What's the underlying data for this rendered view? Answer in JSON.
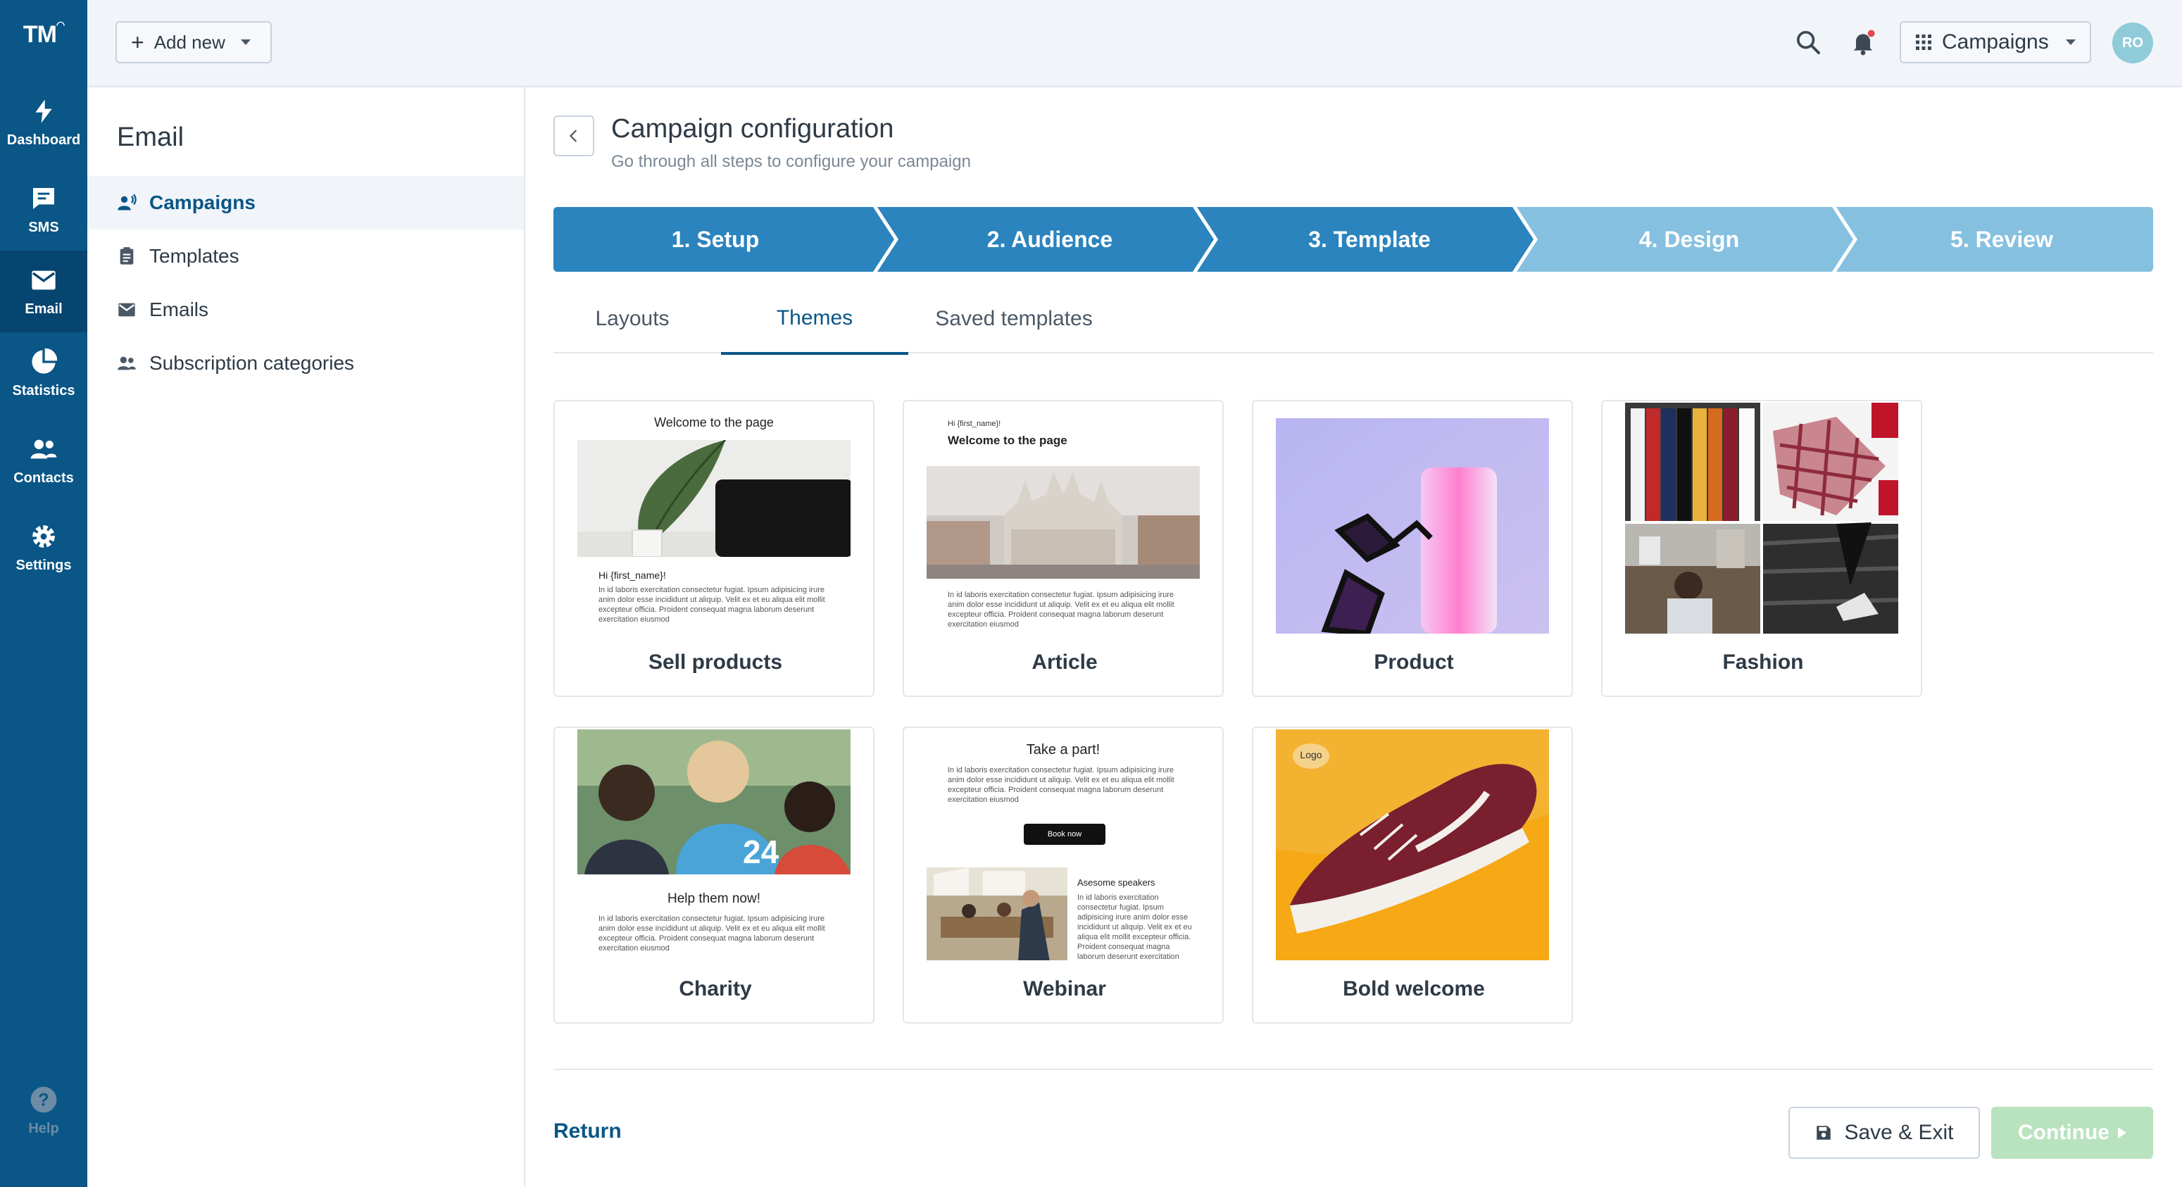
{
  "brand": {
    "logo_text": "TM",
    "accent": "#0a5686",
    "step_active": "#2b84bd",
    "step_inactive": "#86c0e0"
  },
  "rail": {
    "items": [
      {
        "label": "Dashboard",
        "icon": "bolt-icon"
      },
      {
        "label": "SMS",
        "icon": "chat-icon"
      },
      {
        "label": "Email",
        "icon": "envelope-icon",
        "active": true
      },
      {
        "label": "Statistics",
        "icon": "pie-chart-icon"
      },
      {
        "label": "Contacts",
        "icon": "people-icon"
      },
      {
        "label": "Settings",
        "icon": "gear-icon"
      }
    ],
    "help_label": "Help"
  },
  "topbar": {
    "add_new_label": "Add new",
    "campaigns_label": "Campaigns",
    "avatar_initials": "RO"
  },
  "subnav": {
    "title": "Email",
    "items": [
      {
        "label": "Campaigns",
        "active": true
      },
      {
        "label": "Templates"
      },
      {
        "label": "Emails"
      },
      {
        "label": "Subscription categories"
      }
    ]
  },
  "main": {
    "title": "Campaign configuration",
    "subtitle": "Go through all steps to configure your campaign",
    "steps": [
      {
        "label": "1. Setup",
        "done": true
      },
      {
        "label": "2. Audience",
        "done": true
      },
      {
        "label": "3. Template",
        "done": true
      },
      {
        "label": "4. Design",
        "done": false
      },
      {
        "label": "5. Review",
        "done": false
      }
    ],
    "tabs": [
      {
        "label": "Layouts"
      },
      {
        "label": "Themes",
        "active": true
      },
      {
        "label": "Saved templates"
      }
    ],
    "themes": [
      {
        "name": "Sell products"
      },
      {
        "name": "Article"
      },
      {
        "name": "Product"
      },
      {
        "name": "Fashion"
      },
      {
        "name": "Charity"
      },
      {
        "name": "Webinar"
      },
      {
        "name": "Bold welcome"
      }
    ],
    "thumb_text": {
      "sell_heading": "Welcome to the page",
      "sell_greeting": "Hi {first_name}!",
      "lorem": "In id laboris exercitation consectetur fugiat. Ipsum adipisicing irure anim dolor esse incididunt ut aliquip. Velit ex et eu aliqua elit mollit excepteur officia. Proident consequat magna laborum deserunt exercitation eiusmod",
      "article_greeting": "Hi {first_name}!",
      "article_heading": "Welcome to the page",
      "charity_heading": "Help them now!",
      "webinar_heading": "Take a part!",
      "webinar_button": "Book now",
      "webinar_speakers": "Asesome speakers",
      "logo_badge": "Logo"
    },
    "return_label": "Return",
    "save_exit_label": "Save & Exit",
    "continue_label": "Continue"
  }
}
